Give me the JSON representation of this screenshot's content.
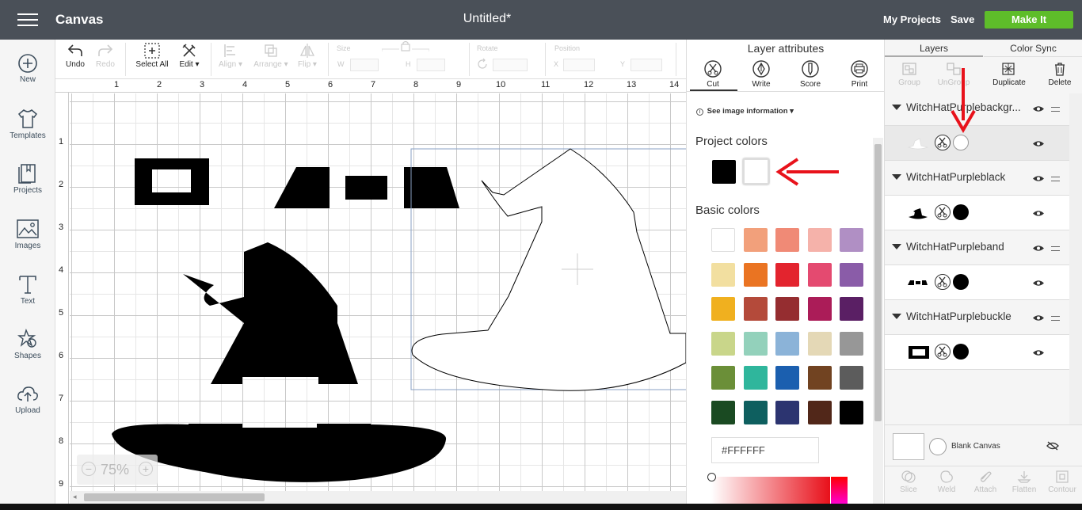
{
  "header": {
    "app_title": "Canvas",
    "doc_title": "Untitled*",
    "my_projects": "My Projects",
    "save": "Save",
    "make_it": "Make It"
  },
  "sidebar": {
    "items": [
      {
        "label": "New",
        "icon": "plus-circle-icon"
      },
      {
        "label": "Templates",
        "icon": "shirt-icon"
      },
      {
        "label": "Projects",
        "icon": "projects-icon"
      },
      {
        "label": "Images",
        "icon": "image-icon"
      },
      {
        "label": "Text",
        "icon": "text-icon"
      },
      {
        "label": "Shapes",
        "icon": "shapes-icon"
      },
      {
        "label": "Upload",
        "icon": "upload-icon"
      }
    ]
  },
  "toolbar": {
    "undo": "Undo",
    "redo": "Redo",
    "select_all": "Select All",
    "edit": "Edit",
    "align": "Align",
    "arrange": "Arrange",
    "flip": "Flip",
    "size": "Size",
    "w": "W",
    "h": "H",
    "rotate": "Rotate",
    "position": "Position",
    "x": "X",
    "y": "Y"
  },
  "rulers": {
    "top": [
      "1",
      "2",
      "3",
      "4",
      "5",
      "6",
      "7",
      "8",
      "9",
      "10",
      "11",
      "12",
      "13",
      "14"
    ],
    "left": [
      "1",
      "2",
      "3",
      "4",
      "5",
      "6",
      "7",
      "8",
      "9"
    ]
  },
  "zoom": {
    "level": "75%",
    "minus": "−",
    "plus": "+"
  },
  "attributes": {
    "title": "Layer attributes",
    "tabs": [
      "Cut",
      "Write",
      "Score",
      "Print"
    ],
    "image_info": "See image information",
    "project_colors_label": "Project colors",
    "project_colors": [
      "#000000",
      "#ffffff"
    ],
    "basic_colors_label": "Basic colors",
    "basic_colors": [
      "#ffffff",
      "#f2a07b",
      "#f08a76",
      "#f5b2aa",
      "#b08fc4",
      "#f2dfa0",
      "#ea7422",
      "#e3242e",
      "#e44a70",
      "#8a5ca8",
      "#f0b01f",
      "#b44a3a",
      "#952d30",
      "#ab1c58",
      "#5a1f64",
      "#c9d68a",
      "#93d1bb",
      "#8bb3d8",
      "#e4d8b6",
      "#979797",
      "#6b8f38",
      "#2fb69c",
      "#1b5faf",
      "#714321",
      "#5c5c5c",
      "#1a4a22",
      "#0e5f5f",
      "#2c3470",
      "#512719",
      "#000000"
    ],
    "hex_value": "#FFFFFF"
  },
  "layers": {
    "tabs": [
      "Layers",
      "Color Sync"
    ],
    "tools": [
      "Group",
      "UnGroup",
      "Duplicate",
      "Delete"
    ],
    "groups": [
      {
        "name": "WitchHatPurplebackground",
        "display_name": "WitchHatPurplebackgr...",
        "child_color": "#ffffff"
      },
      {
        "name": "WitchHatPurpleblack",
        "display_name": "WitchHatPurpleblack",
        "child_color": "#000000"
      },
      {
        "name": "WitchHatPurpleband",
        "display_name": "WitchHatPurpleband",
        "child_color": "#000000"
      },
      {
        "name": "WitchHatPurplebuckle",
        "display_name": "WitchHatPurplebuckle",
        "child_color": "#000000"
      }
    ],
    "blank_canvas": "Blank Canvas",
    "bottom_tools": [
      "Slice",
      "Weld",
      "Attach",
      "Flatten",
      "Contour"
    ]
  },
  "annotation_color": "#e8121b"
}
